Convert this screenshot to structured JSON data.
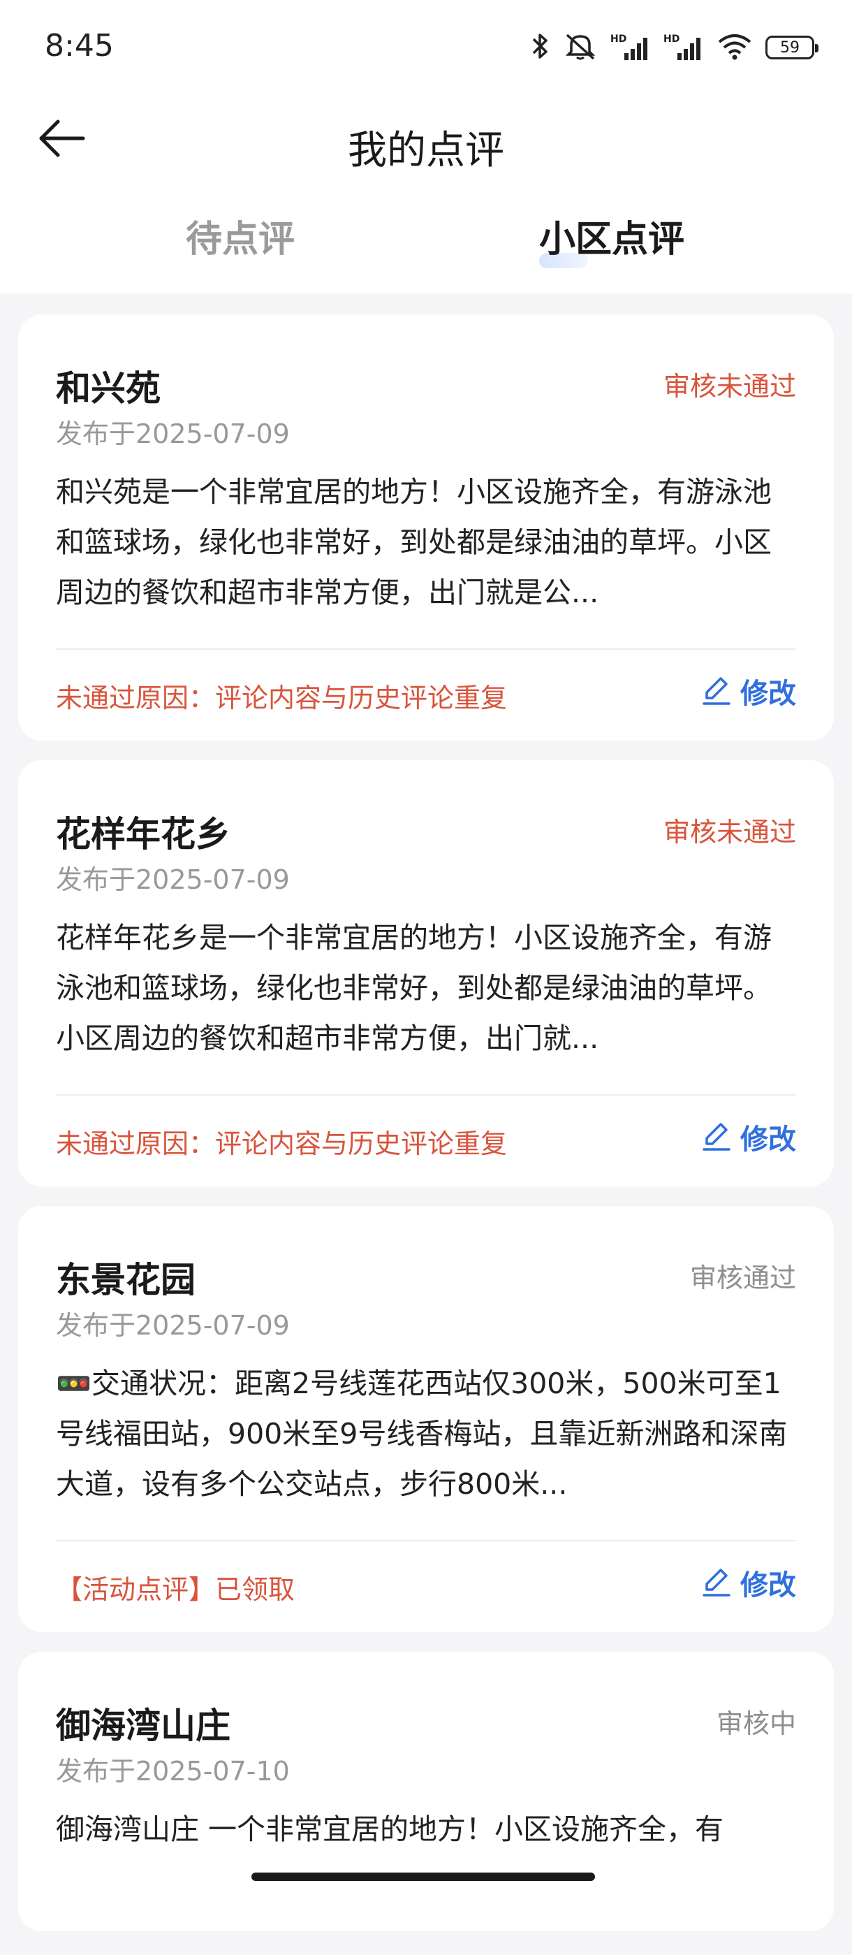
{
  "status_bar": {
    "time": "8:45",
    "battery": "59",
    "hd_label": "HD",
    "icons": [
      "bluetooth-icon",
      "mute-icon",
      "signal-hd-icon",
      "signal-hd-icon",
      "wifi-icon",
      "battery-icon"
    ]
  },
  "header": {
    "title": "我的点评",
    "back_icon": "arrow-left-icon"
  },
  "tabs": [
    {
      "label": "待点评",
      "active": false
    },
    {
      "label": "小区点评",
      "active": true
    }
  ],
  "colors": {
    "accent_blue": "#2f6fde",
    "fail_red": "#d9543b",
    "muted_gray": "#8e8e8e"
  },
  "reviews": [
    {
      "title": "和兴苑",
      "status": "审核未通过",
      "date": "发布于2025-07-09",
      "content": "和兴苑是一个非常宜居的地方！小区设施齐全，有游泳池和篮球场，绿化也非常好，到处都是绿油油的草坪。小区周边的餐饮和超市非常方便，出门就是公...",
      "note": "未通过原因：评论内容与历史评论重复",
      "edit_label": "修改"
    },
    {
      "title": "花样年花乡",
      "status": "审核未通过",
      "date": "发布于2025-07-09",
      "content": "花样年花乡是一个非常宜居的地方！小区设施齐全，有游泳池和篮球场，绿化也非常好，到处都是绿油油的草坪。小区周边的餐饮和超市非常方便，出门就...",
      "note": "未通过原因：评论内容与历史评论重复",
      "edit_label": "修改"
    },
    {
      "title": "东景花园",
      "status": "审核通过",
      "date": "发布于2025-07-09",
      "content": "🚥交通状况：距离2号线莲花西站仅300米，500米可至1号线福田站，900米至9号线香梅站，且靠近新洲路和深南大道，设有多个公交站点，步行800米...",
      "note": "【活动点评】已领取",
      "edit_label": "修改"
    },
    {
      "title": "御海湾山庄",
      "status": "审核中",
      "date": "发布于2025-07-10",
      "content": "御海湾山庄 一个非常宜居的地方！小区设施齐全，有"
    }
  ]
}
